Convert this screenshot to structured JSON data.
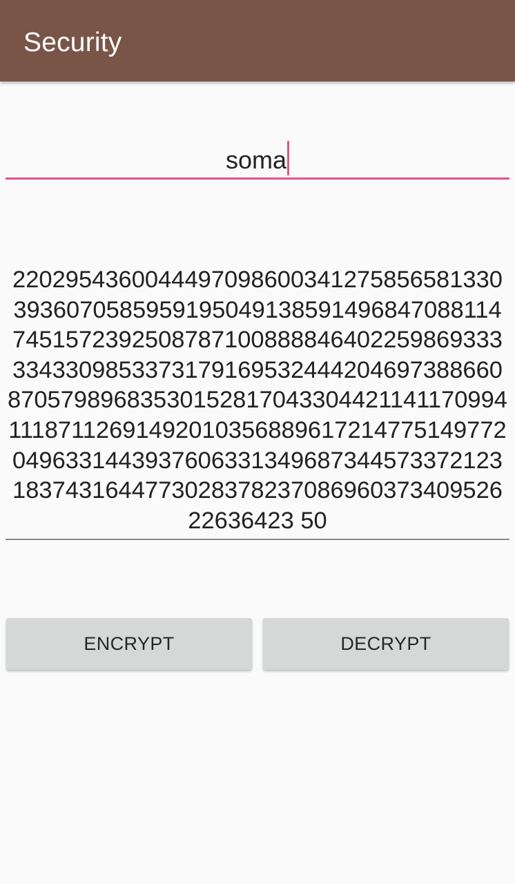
{
  "app_bar": {
    "title": "Security",
    "color": "#795548"
  },
  "input": {
    "value": "soma",
    "accent_color": "#e5538b"
  },
  "output": {
    "text": "220295436004449709860034127585658133039360705859591950491385914968470881147451572392508787100888846402259869333334330985337317916953244420469738866087057989683530152817043304421141170994111871126914920103568896172147751497720496331443937606331349687344573372123183743164477302837823708696037340952622636423 50"
  },
  "buttons": {
    "encrypt_label": "ENCRYPT",
    "decrypt_label": "DECRYPT"
  }
}
